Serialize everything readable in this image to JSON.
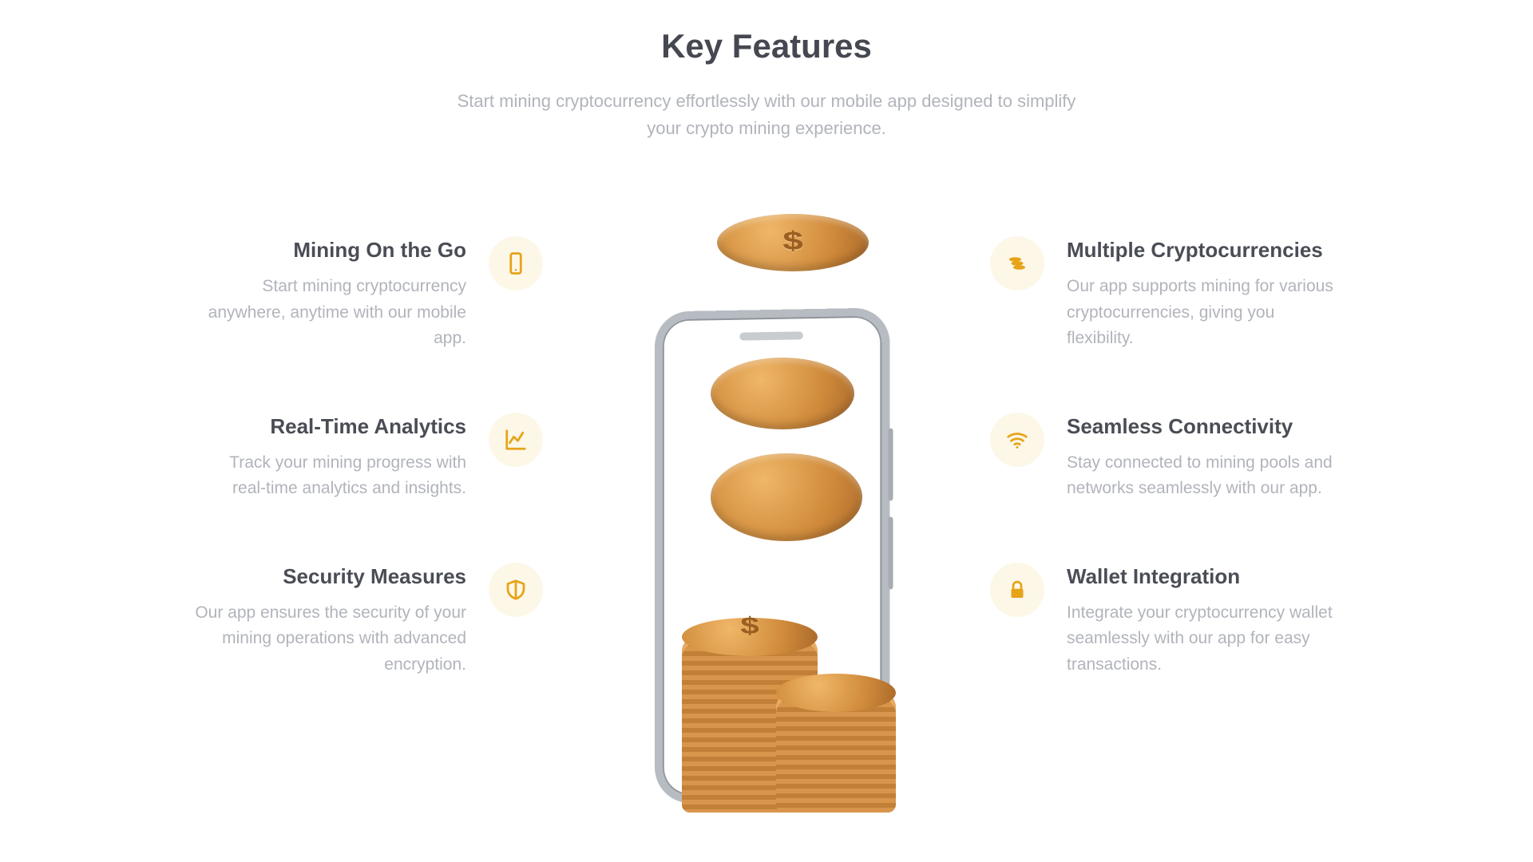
{
  "header": {
    "title": "Key Features",
    "subtitle": "Start mining cryptocurrency effortlessly with our mobile app designed to simplify your crypto mining experience."
  },
  "features_left": [
    {
      "title": "Mining On the Go",
      "desc": "Start mining cryptocurrency anywhere, anytime with our mobile app."
    },
    {
      "title": "Real-Time Analytics",
      "desc": "Track your mining progress with real-time analytics and insights."
    },
    {
      "title": "Security Measures",
      "desc": "Our app ensures the security of your mining operations with advanced encryption."
    }
  ],
  "features_right": [
    {
      "title": "Multiple Cryptocurrencies",
      "desc": "Our app supports mining for various cryptocurrencies, giving you flexibility."
    },
    {
      "title": "Seamless Connectivity",
      "desc": "Stay connected to mining pools and networks seamlessly with our app."
    },
    {
      "title": "Wallet Integration",
      "desc": "Integrate your cryptocurrency wallet seamlessly with our app for easy transactions."
    }
  ],
  "colors": {
    "accent": "#e7a318",
    "icon_bg": "#fdf7e8"
  },
  "dollar_sign": "$"
}
